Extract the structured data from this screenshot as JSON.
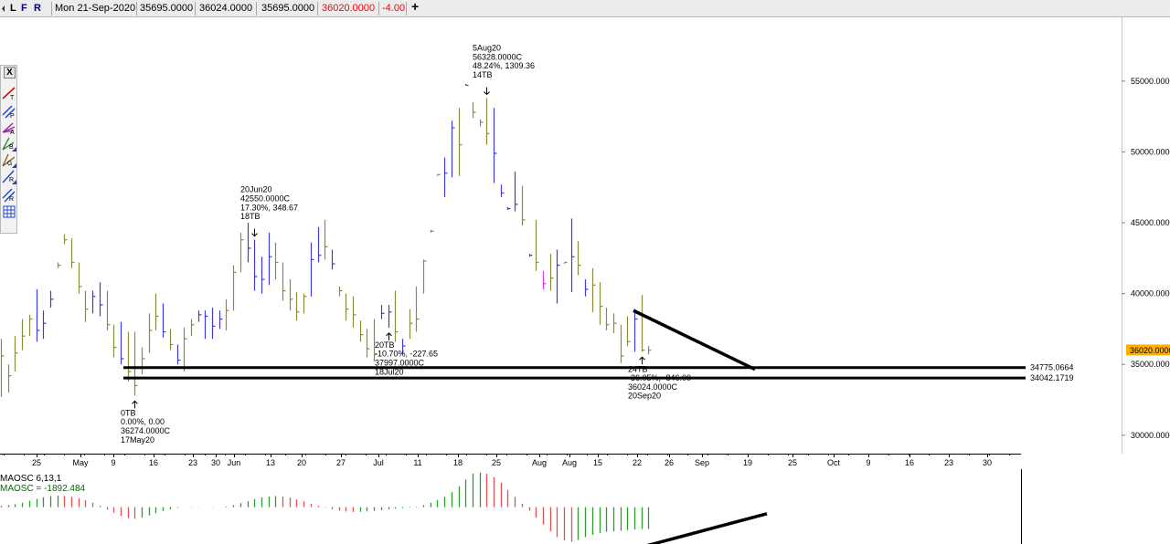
{
  "toolbar": {
    "buttons": [
      "L",
      "F",
      "R"
    ],
    "date": "Mon 21-Sep-2020",
    "open": "35695.0000",
    "high": "36024.0000",
    "low": "35695.0000",
    "close": "36020.0000",
    "change": "-4.00",
    "add_label": "+",
    "close_color": "#ff0000",
    "change_color": "#ff0000"
  },
  "palette": {
    "close_label": "X",
    "tools": [
      "trend-line-icon",
      "parallel-lines-icon",
      "andrews-pitchfork-icon",
      "fan-b-icon",
      "gann-fan-icon",
      "regression-line-icon",
      "regression-channel-icon",
      "grid-icon"
    ]
  },
  "chart_data": [
    {
      "type": "bar",
      "chart_style": "ohlc",
      "y_axis": {
        "ticks": [
          "55000.0000",
          "50000.0000",
          "45000.0000",
          "40000.0000",
          "35000.0000",
          "30000.0000"
        ],
        "values": [
          55000,
          50000,
          45000,
          40000,
          35000,
          30000
        ],
        "ylim": [
          28700,
          59500
        ],
        "current_value_label": "36020.0000",
        "current_value": 36020,
        "current_value_color": "#ffb000"
      },
      "x_axis": {
        "ticks": [
          "25",
          "May",
          "9",
          "16",
          "23",
          "30",
          "Jun",
          "13",
          "20",
          "27",
          "Jul",
          "11",
          "18",
          "25",
          "Aug",
          "Aug",
          "15",
          "22",
          "26",
          "Sep",
          "19",
          "25",
          "Oct",
          "9",
          "16",
          "23",
          "30"
        ]
      },
      "support_lines": [
        {
          "label": "34775.0664",
          "value": 34775.0664
        },
        {
          "label": "34042.1719",
          "value": 34042.1719
        }
      ],
      "trend_line": {
        "from": [
          38800,
          0.693
        ],
        "to": [
          34650,
          0.826
        ]
      },
      "up_color": "#3d3dd6",
      "down_color": "#8b8b3c",
      "special_color": "#e040e0",
      "bars": [
        [
          36800,
          32700,
          35600
        ],
        [
          35000,
          33000,
          34200
        ],
        [
          37000,
          34500,
          35800
        ],
        [
          38200,
          36000,
          37000
        ],
        [
          38500,
          37000,
          38200
        ],
        [
          40300,
          36600,
          37400
        ],
        [
          38800,
          36800,
          37900
        ],
        [
          40200,
          39000,
          39600
        ],
        [
          42200,
          41800,
          42000
        ],
        [
          44200,
          43500,
          43800
        ],
        [
          43900,
          41800,
          42200
        ],
        [
          42200,
          40000,
          40500
        ],
        [
          40200,
          38000,
          38900
        ],
        [
          40200,
          38600,
          39800
        ],
        [
          40800,
          38400,
          39200
        ],
        [
          40200,
          37400,
          37800
        ],
        [
          37800,
          35500,
          36200
        ],
        [
          38000,
          35000,
          35400
        ],
        [
          37300,
          33800,
          34500
        ],
        [
          37300,
          32800,
          33500
        ],
        [
          36200,
          34300,
          35400
        ],
        [
          38600,
          35800,
          37400
        ],
        [
          40000,
          37400,
          38400
        ],
        [
          39300,
          36900,
          37300
        ],
        [
          37500,
          36000,
          36400
        ],
        [
          36400,
          35000,
          35300
        ],
        [
          37600,
          34500,
          36800
        ],
        [
          38200,
          37000,
          37800
        ],
        [
          38800,
          38000,
          38500
        ],
        [
          38800,
          36800,
          38400
        ],
        [
          39000,
          36800,
          37700
        ],
        [
          38800,
          37500,
          38200
        ],
        [
          39600,
          37400,
          38800
        ],
        [
          42000,
          38800,
          41500
        ],
        [
          44300,
          41500,
          43800
        ],
        [
          45000,
          42200,
          43200
        ],
        [
          43800,
          40200,
          41200
        ],
        [
          42600,
          40000,
          41000
        ],
        [
          44300,
          40600,
          42600
        ],
        [
          43600,
          41000,
          42200
        ],
        [
          42200,
          39500,
          40200
        ],
        [
          41000,
          38800,
          39600
        ],
        [
          40100,
          38100,
          38700
        ],
        [
          40000,
          38600,
          39800
        ],
        [
          43600,
          39800,
          42400
        ],
        [
          44700,
          42200,
          42700
        ],
        [
          45200,
          42400,
          43300
        ],
        [
          43100,
          41700,
          42100
        ],
        [
          40500,
          39800,
          40200
        ],
        [
          40000,
          38100,
          38900
        ],
        [
          39800,
          37600,
          38500
        ],
        [
          38100,
          36600,
          37100
        ],
        [
          37500,
          35500,
          36100
        ],
        [
          38200,
          35200,
          35700
        ],
        [
          39200,
          38200,
          38600
        ],
        [
          39200,
          37600,
          38700
        ],
        [
          40200,
          36600,
          37300
        ],
        [
          36800,
          35700,
          36300
        ],
        [
          38900,
          36800,
          37900
        ],
        [
          40500,
          37300,
          38200
        ],
        [
          42400,
          40000,
          42300
        ],
        [
          44500,
          44300,
          44400
        ],
        [
          48400,
          48300,
          48400
        ],
        [
          49600,
          46800,
          48500
        ],
        [
          52200,
          48200,
          51700
        ],
        [
          53100,
          48300,
          50500
        ],
        [
          54800,
          54700,
          54700
        ],
        [
          53500,
          52400,
          52800
        ],
        [
          52300,
          51800,
          52100
        ],
        [
          53800,
          50500,
          51300
        ],
        [
          53100,
          47800,
          49900
        ],
        [
          47700,
          46800,
          47100
        ],
        [
          46100,
          45900,
          46000
        ],
        [
          48600,
          45800,
          46300
        ],
        [
          47600,
          44800,
          45200
        ],
        [
          42800,
          42600,
          42700
        ],
        [
          45200,
          41600,
          42200
        ],
        [
          41600,
          40300,
          40700
        ],
        [
          42800,
          40200,
          41100
        ],
        [
          43100,
          39300,
          42000
        ],
        [
          42200,
          42100,
          42200
        ],
        [
          45300,
          40100,
          42600
        ],
        [
          43700,
          41300,
          42000
        ],
        [
          41000,
          39800,
          40300
        ],
        [
          41800,
          38700,
          40600
        ],
        [
          40800,
          37800,
          39100
        ],
        [
          39000,
          37400,
          37800
        ],
        [
          38600,
          37200,
          37900
        ],
        [
          37800,
          35100,
          35600
        ],
        [
          38400,
          36300,
          36600
        ],
        [
          38900,
          35900,
          38200
        ],
        [
          39900,
          35900,
          36000
        ],
        [
          36300,
          35700,
          36000
        ]
      ],
      "bar_kinds": [
        "d",
        "d",
        "d",
        "d",
        "d",
        "u",
        "u",
        "u",
        "d",
        "d",
        "d",
        "d",
        "d",
        "u",
        "u",
        "d",
        "d",
        "u",
        "d",
        "d",
        "d",
        "d",
        "d",
        "u",
        "d",
        "u",
        "d",
        "d",
        "u",
        "u",
        "u",
        "u",
        "d",
        "d",
        "d",
        "u",
        "u",
        "u",
        "u",
        "d",
        "d",
        "d",
        "d",
        "d",
        "u",
        "u",
        "d",
        "u",
        "d",
        "d",
        "d",
        "d",
        "d",
        "d",
        "u",
        "u",
        "d",
        "u",
        "d",
        "d",
        "d",
        "d",
        "d",
        "u",
        "u",
        "d",
        "u",
        "d",
        "d",
        "d",
        "u",
        "u",
        "u",
        "u",
        "d",
        "u",
        "d",
        "s",
        "d",
        "u",
        "d",
        "u",
        "d",
        "u",
        "d",
        "d",
        "d",
        "d",
        "d",
        "d",
        "u",
        "d",
        "d"
      ],
      "annotations": [
        {
          "anchor": 36,
          "dir": "down",
          "lines": [
            "20Jun20",
            "42550.0000C",
            "17.30%, 348.67",
            "18TB"
          ]
        },
        {
          "anchor": 69,
          "dir": "down",
          "lines": [
            "5Aug20",
            "56328.0000C",
            "48.24%, 1309.36",
            "14TB"
          ]
        },
        {
          "anchor": 19,
          "dir": "up",
          "lines": [
            "0TB",
            "0.00%, 0.00",
            "36274.0000C",
            "17May20"
          ]
        },
        {
          "anchor": 55,
          "dir": "up",
          "lines": [
            "20TB",
            "-10.70%, -227.65",
            "37997.0000C",
            "18Jul20"
          ]
        },
        {
          "anchor": 91,
          "dir": "up",
          "lines": [
            "24TB",
            "-36.05%, -846.00",
            "36024.0000C",
            "20Sep20"
          ]
        }
      ]
    },
    {
      "type": "bar",
      "series": [
        {
          "name": "MAOSC 6,13,1"
        }
      ],
      "value_label": "MAOSC = -1892.484",
      "value_color": "#008800",
      "up_color": "#2e9b2e",
      "down_color": "#e05050",
      "values": [
        120,
        180,
        250,
        380,
        550,
        720,
        860,
        960,
        1000,
        980,
        900,
        780,
        600,
        380,
        120,
        -200,
        -480,
        -760,
        -950,
        -1020,
        -900,
        -720,
        -520,
        -330,
        -180,
        -60,
        10,
        30,
        20,
        0,
        -20,
        0,
        60,
        180,
        340,
        520,
        700,
        840,
        920,
        960,
        920,
        820,
        680,
        500,
        300,
        120,
        -40,
        -180,
        -300,
        -380,
        -420,
        -410,
        -370,
        -310,
        -260,
        -190,
        -130,
        -90,
        -40,
        50,
        180,
        380,
        620,
        900,
        1300,
        1800,
        2400,
        2900,
        3000,
        2900,
        2600,
        2100,
        1500,
        900,
        300,
        -300,
        -900,
        -1500,
        -2100,
        -2600,
        -2900,
        -3000,
        -2850,
        -2600,
        -2400,
        -2250,
        -2150,
        -2100,
        -2050,
        -2000,
        -1950,
        -1900,
        -1892
      ],
      "ylim": [
        -3200,
        3300
      ],
      "trend_line": {
        "from": [
          -3400,
          0.635
        ],
        "to": [
          -2000,
          0.752
        ]
      }
    }
  ]
}
